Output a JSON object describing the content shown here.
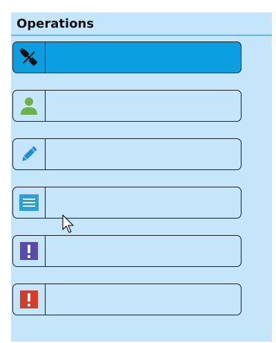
{
  "panel": {
    "title": "Operations"
  },
  "operations": [
    {
      "icon": "disconnect-plug-icon",
      "label": "",
      "active": true
    },
    {
      "icon": "user-icon",
      "label": "",
      "active": false
    },
    {
      "icon": "pencil-icon",
      "label": "",
      "active": false
    },
    {
      "icon": "list-document-icon",
      "label": "",
      "active": false
    },
    {
      "icon": "warning-purple-icon",
      "label": "",
      "active": false
    },
    {
      "icon": "error-red-icon",
      "label": "",
      "active": false
    }
  ],
  "colors": {
    "panel_bg": "#c4e5fa",
    "header_rule": "#62b6e3",
    "active_bg": "#0b9ee0",
    "user_green": "#6cb33f",
    "pencil_blue": "#1f8fd1",
    "list_blue": "#2aa0d8",
    "warning_purple": "#5a4ba8",
    "error_red": "#d63c2a"
  }
}
